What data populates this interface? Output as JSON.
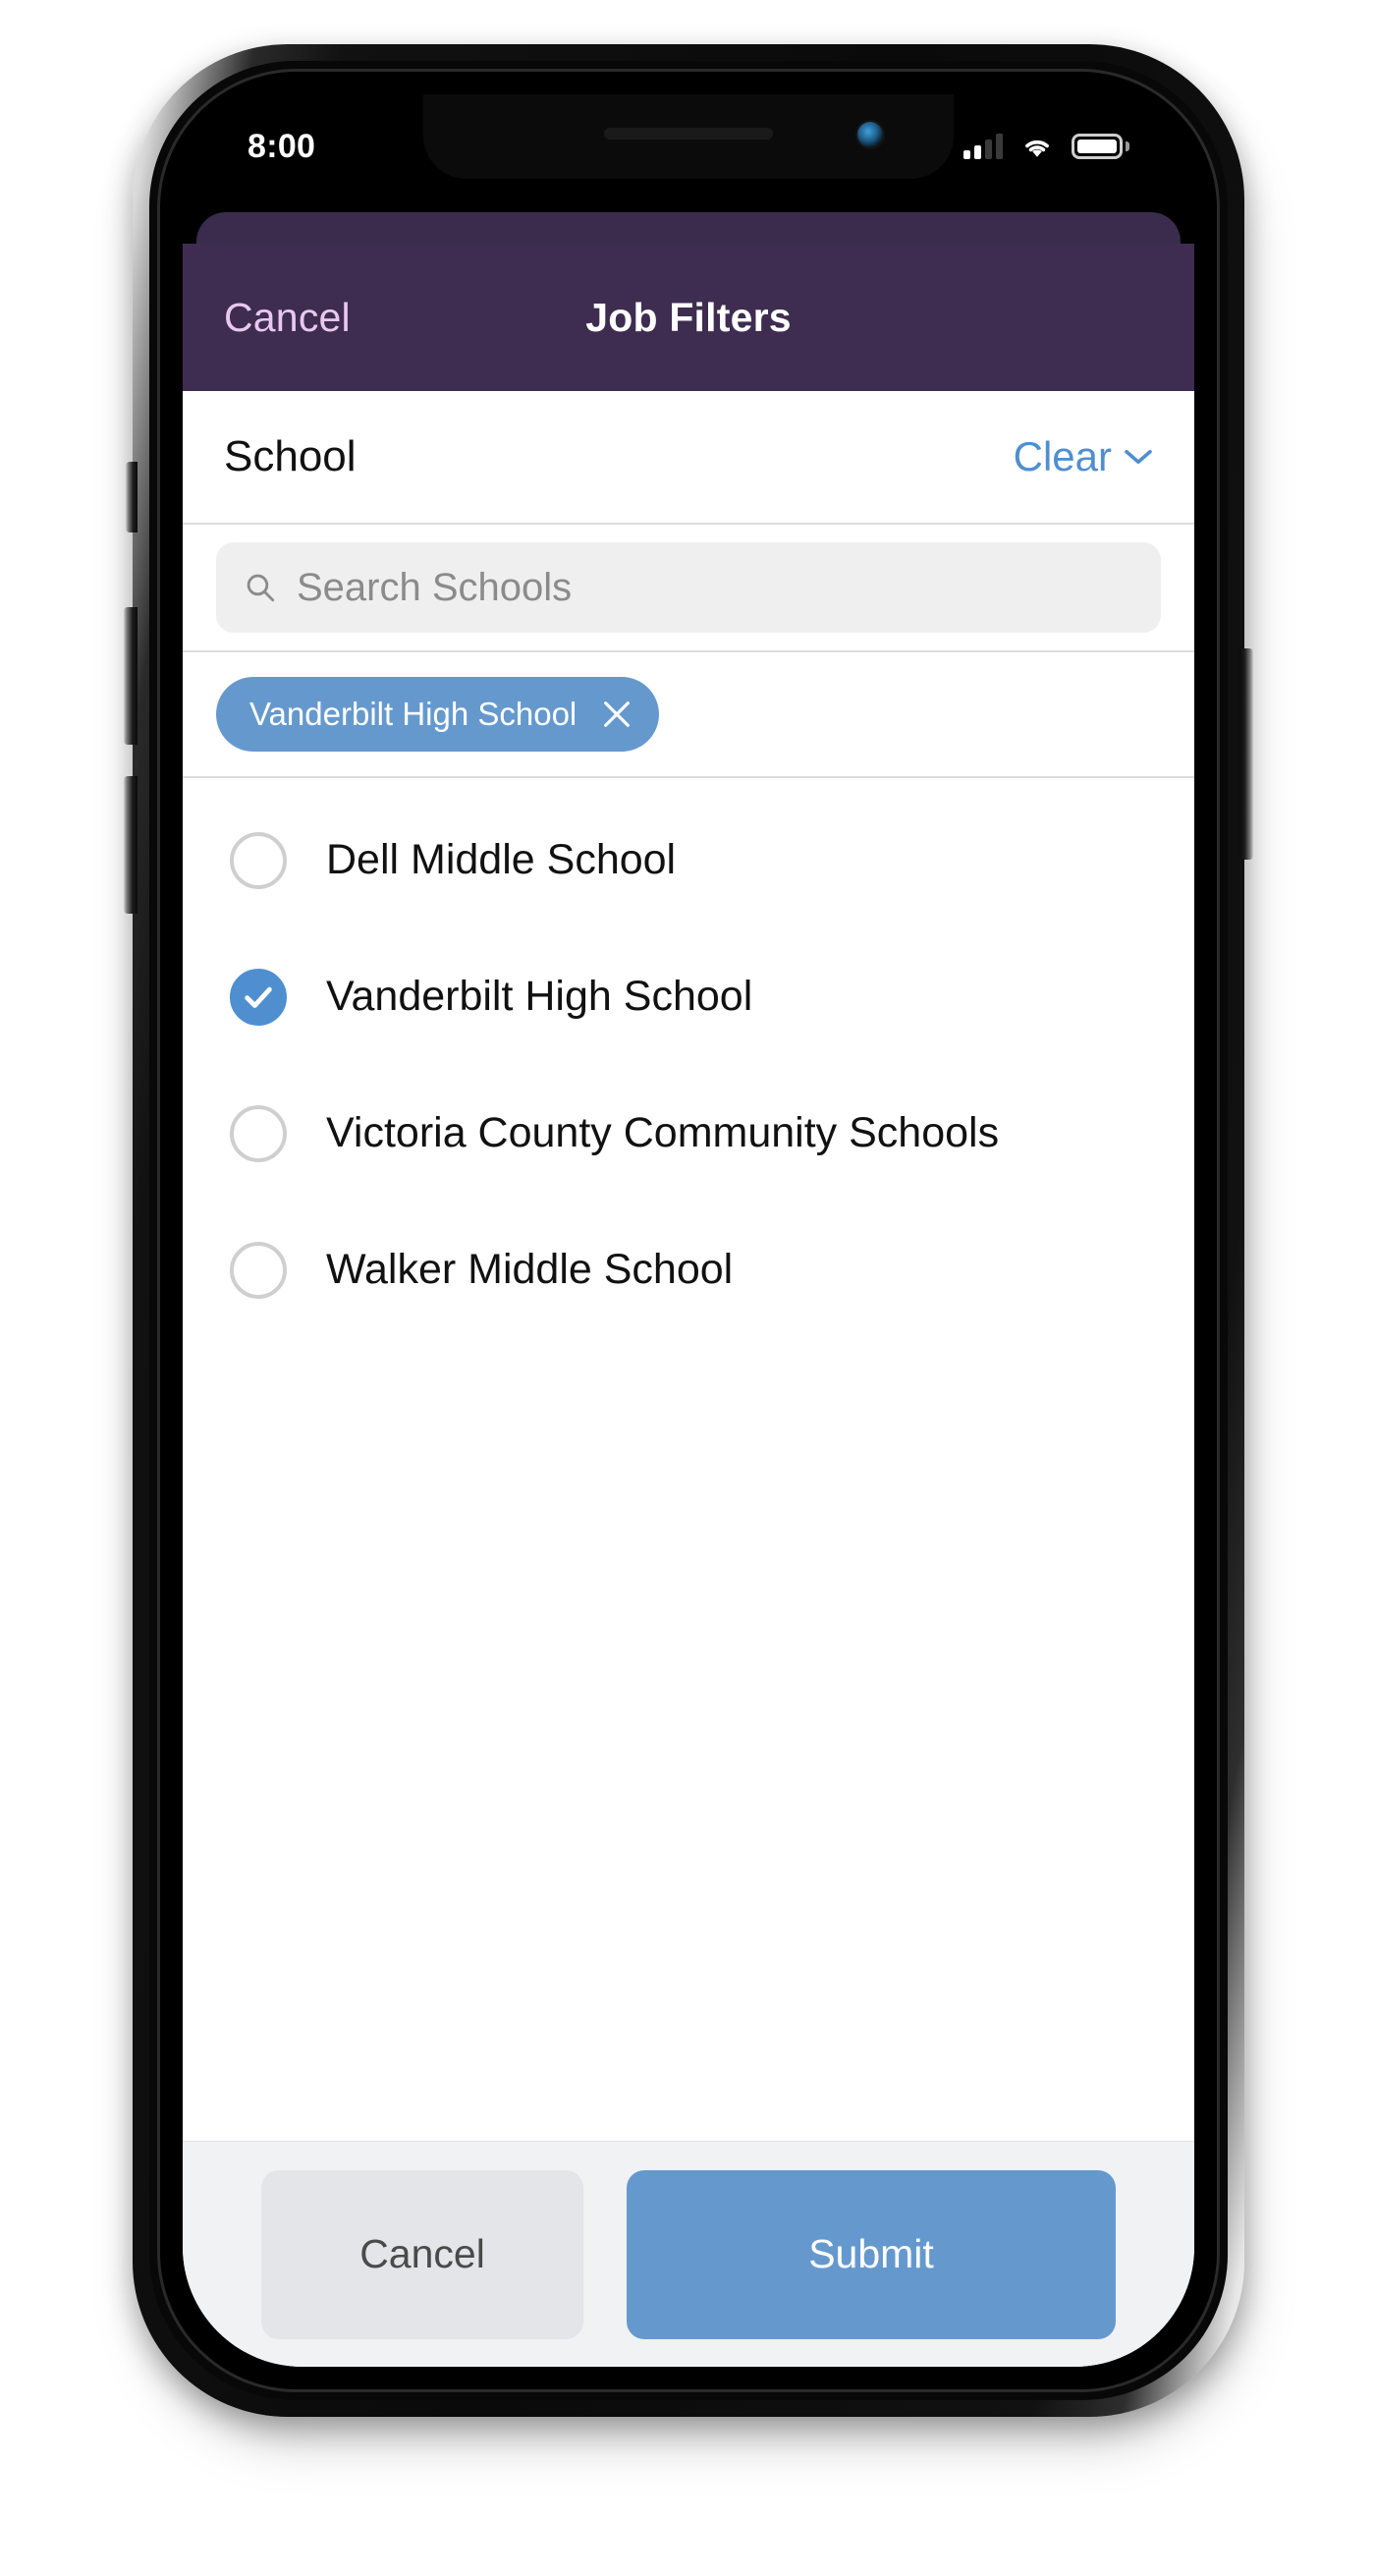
{
  "status_bar": {
    "time": "8:00",
    "signal_icon": "signal-bars-icon",
    "wifi_icon": "wifi-icon",
    "battery_icon": "battery-full-icon"
  },
  "nav": {
    "cancel_label": "Cancel",
    "title": "Job Filters"
  },
  "section": {
    "title": "School",
    "clear_label": "Clear",
    "chevron_icon": "chevron-down-icon"
  },
  "search": {
    "placeholder": "Search Schools",
    "value": "",
    "icon": "search-icon"
  },
  "chips": [
    {
      "label": "Vanderbilt High School",
      "close_icon": "close-icon"
    }
  ],
  "options": [
    {
      "label": "Dell Middle School",
      "selected": false
    },
    {
      "label": "Vanderbilt High School",
      "selected": true
    },
    {
      "label": "Victoria County Community Schools",
      "selected": false
    },
    {
      "label": "Walker Middle School",
      "selected": false
    }
  ],
  "footer": {
    "cancel_label": "Cancel",
    "submit_label": "Submit"
  },
  "colors": {
    "header_purple": "#3e2d50",
    "sheet_back_purple": "#3b2b4d",
    "accent_blue": "#4f8fd0",
    "chip_blue": "#6599ce",
    "cancel_link": "#e9c8ef",
    "footer_bg": "#f1f2f4",
    "cancel_button_bg": "#e3e5e8"
  }
}
